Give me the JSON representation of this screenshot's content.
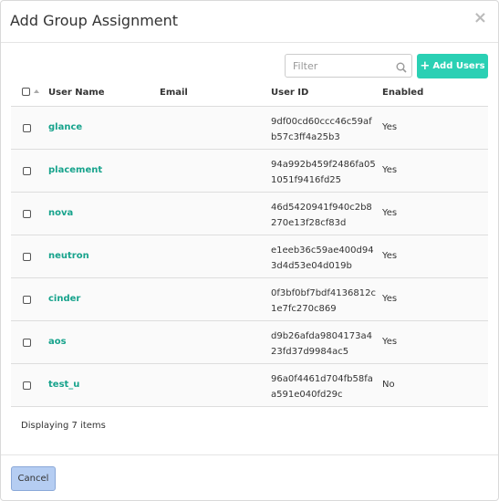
{
  "modal": {
    "title": "Add Group Assignment",
    "close_label": "×"
  },
  "toolbar": {
    "filter_placeholder": "Filter",
    "add_users_label": "Add Users"
  },
  "table": {
    "columns": [
      "User Name",
      "Email",
      "User ID",
      "Enabled"
    ],
    "rows": [
      {
        "name": "glance",
        "email": "",
        "id": "9df00cd60ccc46c59afb57c3ff4a25b3",
        "enabled": "Yes"
      },
      {
        "name": "placement",
        "email": "",
        "id": "94a992b459f2486fa051051f9416fd25",
        "enabled": "Yes"
      },
      {
        "name": "nova",
        "email": "",
        "id": "46d5420941f940c2b8270e13f28cf83d",
        "enabled": "Yes"
      },
      {
        "name": "neutron",
        "email": "",
        "id": "e1eeb36c59ae400d943d4d53e04d019b",
        "enabled": "Yes"
      },
      {
        "name": "cinder",
        "email": "",
        "id": "0f3bf0bf7bdf4136812c1e7fc270c869",
        "enabled": "Yes"
      },
      {
        "name": "aos",
        "email": "",
        "id": "d9b26afda9804173a423fd37d9984ac5",
        "enabled": "Yes"
      },
      {
        "name": "test_u",
        "email": "",
        "id": "96a0f4461d704fb58faa591e040fd29c",
        "enabled": "No"
      }
    ],
    "footer": "Displaying 7 items"
  },
  "footer": {
    "cancel_label": "Cancel"
  },
  "colors": {
    "accent": "#2ad0b4",
    "link": "#17a38c",
    "cancel_bg": "#b5cdf2"
  }
}
